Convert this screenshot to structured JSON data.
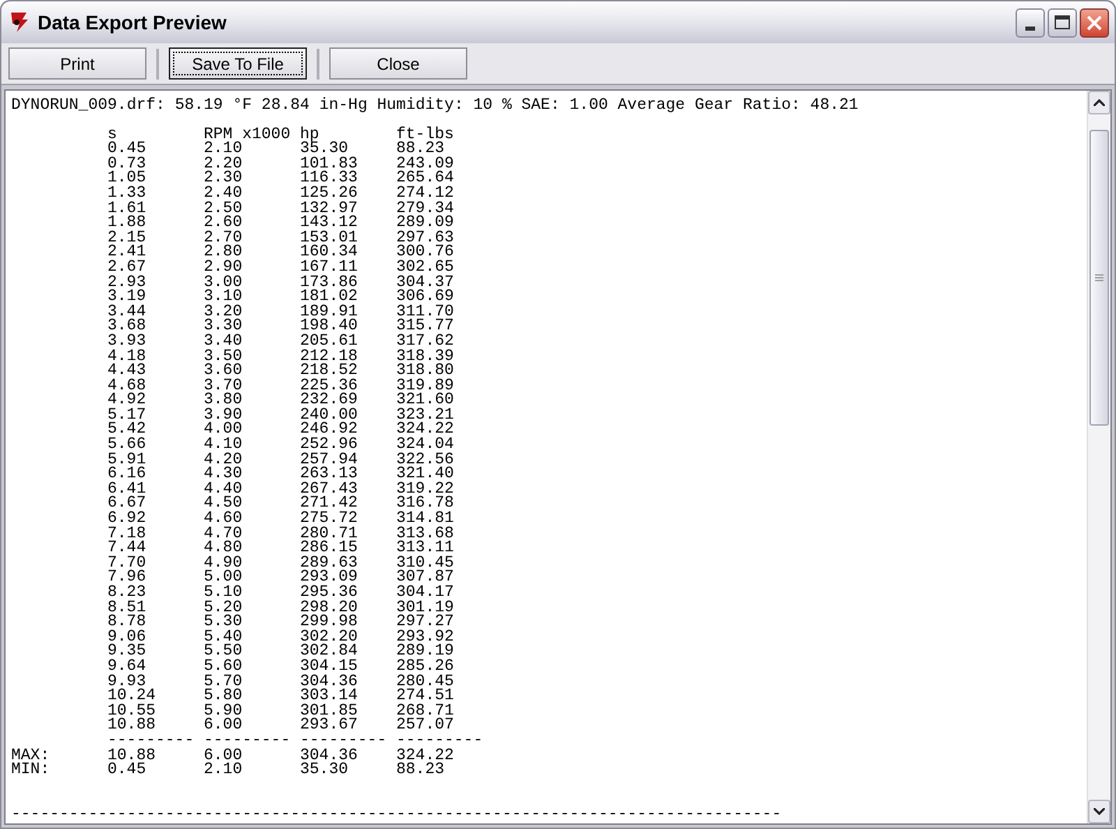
{
  "window": {
    "title": "Data Export Preview"
  },
  "buttons": [
    {
      "label": "Print",
      "focused": false
    },
    {
      "label": "Save To File",
      "focused": true
    },
    {
      "label": "Close",
      "focused": false
    }
  ],
  "report": {
    "info": "DYNORUN_009.drf: 58.19 °F 28.84 in-Hg Humidity: 10 % SAE: 1.00 Average Gear Ratio: 48.21",
    "columns": [
      "s",
      "RPM x1000",
      "hp",
      "ft-lbs"
    ],
    "rows": [
      [
        "0.45",
        "2.10",
        "35.30",
        "88.23"
      ],
      [
        "0.73",
        "2.20",
        "101.83",
        "243.09"
      ],
      [
        "1.05",
        "2.30",
        "116.33",
        "265.64"
      ],
      [
        "1.33",
        "2.40",
        "125.26",
        "274.12"
      ],
      [
        "1.61",
        "2.50",
        "132.97",
        "279.34"
      ],
      [
        "1.88",
        "2.60",
        "143.12",
        "289.09"
      ],
      [
        "2.15",
        "2.70",
        "153.01",
        "297.63"
      ],
      [
        "2.41",
        "2.80",
        "160.34",
        "300.76"
      ],
      [
        "2.67",
        "2.90",
        "167.11",
        "302.65"
      ],
      [
        "2.93",
        "3.00",
        "173.86",
        "304.37"
      ],
      [
        "3.19",
        "3.10",
        "181.02",
        "306.69"
      ],
      [
        "3.44",
        "3.20",
        "189.91",
        "311.70"
      ],
      [
        "3.68",
        "3.30",
        "198.40",
        "315.77"
      ],
      [
        "3.93",
        "3.40",
        "205.61",
        "317.62"
      ],
      [
        "4.18",
        "3.50",
        "212.18",
        "318.39"
      ],
      [
        "4.43",
        "3.60",
        "218.52",
        "318.80"
      ],
      [
        "4.68",
        "3.70",
        "225.36",
        "319.89"
      ],
      [
        "4.92",
        "3.80",
        "232.69",
        "321.60"
      ],
      [
        "5.17",
        "3.90",
        "240.00",
        "323.21"
      ],
      [
        "5.42",
        "4.00",
        "246.92",
        "324.22"
      ],
      [
        "5.66",
        "4.10",
        "252.96",
        "324.04"
      ],
      [
        "5.91",
        "4.20",
        "257.94",
        "322.56"
      ],
      [
        "6.16",
        "4.30",
        "263.13",
        "321.40"
      ],
      [
        "6.41",
        "4.40",
        "267.43",
        "319.22"
      ],
      [
        "6.67",
        "4.50",
        "271.42",
        "316.78"
      ],
      [
        "6.92",
        "4.60",
        "275.72",
        "314.81"
      ],
      [
        "7.18",
        "4.70",
        "280.71",
        "313.68"
      ],
      [
        "7.44",
        "4.80",
        "286.15",
        "313.11"
      ],
      [
        "7.70",
        "4.90",
        "289.63",
        "310.45"
      ],
      [
        "7.96",
        "5.00",
        "293.09",
        "307.87"
      ],
      [
        "8.23",
        "5.10",
        "295.36",
        "304.17"
      ],
      [
        "8.51",
        "5.20",
        "298.20",
        "301.19"
      ],
      [
        "8.78",
        "5.30",
        "299.98",
        "297.27"
      ],
      [
        "9.06",
        "5.40",
        "302.20",
        "293.92"
      ],
      [
        "9.35",
        "5.50",
        "302.84",
        "289.19"
      ],
      [
        "9.64",
        "5.60",
        "304.15",
        "285.26"
      ],
      [
        "9.93",
        "5.70",
        "304.36",
        "280.45"
      ],
      [
        "10.24",
        "5.80",
        "303.14",
        "274.51"
      ],
      [
        "10.55",
        "5.90",
        "301.85",
        "268.71"
      ],
      [
        "10.88",
        "6.00",
        "293.67",
        "257.07"
      ]
    ],
    "separators": [
      "---------",
      "---------",
      "---------",
      "---------"
    ],
    "summary": [
      {
        "label": "MAX:",
        "values": [
          "10.88",
          "6.00",
          "304.36",
          "324.22"
        ]
      },
      {
        "label": "MIN:",
        "values": [
          "0.45",
          "2.10",
          "35.30",
          "88.23"
        ]
      }
    ],
    "rule": "--------------------------------------------------------------------------------"
  }
}
